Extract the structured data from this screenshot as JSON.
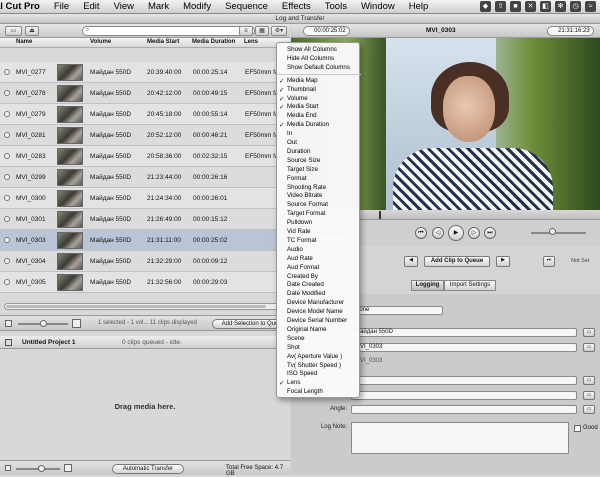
{
  "menubar": {
    "app": "al Cut Pro",
    "items": [
      "File",
      "Edit",
      "View",
      "Mark",
      "Modify",
      "Sequence",
      "Effects",
      "Tools",
      "Window",
      "Help"
    ]
  },
  "window": {
    "title": "Log and Transfer"
  },
  "browser": {
    "columns": [
      "Name",
      "Volume",
      "Media Start",
      "Media Duration",
      "Lens"
    ],
    "rows": [
      {
        "name": "MVI_0277",
        "volume": "Майдан 550D",
        "start": "20:39:40:00",
        "duration": "00:00:25:14",
        "lens": "EF50mm f/"
      },
      {
        "name": "MVI_0278",
        "volume": "Майдан 550D",
        "start": "20:42:12:00",
        "duration": "00:00:49:15",
        "lens": "EF50mm f/"
      },
      {
        "name": "MVI_0279",
        "volume": "Майдан 550D",
        "start": "20:45:18:00",
        "duration": "00:00:55:14",
        "lens": "EF50mm f/"
      },
      {
        "name": "MVI_0281",
        "volume": "Майдан 550D",
        "start": "20:52:12:00",
        "duration": "00:00:46:21",
        "lens": "EF50mm f/"
      },
      {
        "name": "MVI_0283",
        "volume": "Майдан 550D",
        "start": "20:58:36:00",
        "duration": "00:02:32:15",
        "lens": "EF50mm f/"
      },
      {
        "name": "MVI_0299",
        "volume": "Майдан 550D",
        "start": "21:23:44:00",
        "duration": "00:00:26:16",
        "lens": ""
      },
      {
        "name": "MVI_0300",
        "volume": "Майдан 550D",
        "start": "21:24:34:00",
        "duration": "00:00:26:01",
        "lens": ""
      },
      {
        "name": "MVI_0301",
        "volume": "Майдан 550D",
        "start": "21:26:49:00",
        "duration": "00:00:15:12",
        "lens": ""
      },
      {
        "name": "MVI_0303",
        "volume": "Майдан 550D",
        "start": "21:31:11:00",
        "duration": "00:00:25:02",
        "lens": ""
      },
      {
        "name": "MVI_0304",
        "volume": "Майдан 550D",
        "start": "21:32:29:00",
        "duration": "00:00:09:12",
        "lens": ""
      },
      {
        "name": "MVI_0305",
        "volume": "Майдан 550D",
        "start": "21:32:56:00",
        "duration": "00:00:29:03",
        "lens": ""
      }
    ],
    "status": "1 selected - 1 vol... 11 clips displayed",
    "add_selection": "Add Selection to Que",
    "project_name": "Untitled Project 1",
    "queue_status": "0 clips queued - idle.",
    "drop_text": "Drag media here.",
    "auto_transfer": "Automatic Transfer",
    "free_space": "Total Free Space: 4.7 GB"
  },
  "viewer": {
    "timecode_in": "00:00:25:02",
    "clip_name": "MVI_0303",
    "timecode_out": "21:31:16:23",
    "add_clip": "Add Clip to Queue",
    "not_set": "Not Set"
  },
  "logging": {
    "tabs": [
      "Logging",
      "Import Settings"
    ],
    "bin_value": "None",
    "reel_value": "Майдан 550D",
    "name_value": "MVI_0303",
    "name_preview": "MVI_0303",
    "angle_label": "Angle:",
    "lognote_label": "Log Note:",
    "good_label": "Good"
  },
  "column_menu": {
    "top": [
      "Show All Columns",
      "Hide All Columns",
      "Show Default Columns"
    ],
    "items": [
      {
        "label": "Media Map",
        "checked": true
      },
      {
        "label": "Thumbnail",
        "checked": true
      },
      {
        "label": "Volume",
        "checked": true
      },
      {
        "label": "Media Start",
        "checked": true
      },
      {
        "label": "Media End",
        "checked": false
      },
      {
        "label": "Media Duration",
        "checked": true
      },
      {
        "label": "In",
        "checked": false
      },
      {
        "label": "Out",
        "checked": false
      },
      {
        "label": "Duration",
        "checked": false
      },
      {
        "label": "Source Size",
        "checked": false
      },
      {
        "label": "Target Size",
        "checked": false
      },
      {
        "label": "Format",
        "checked": false
      },
      {
        "label": "Shooting Rate",
        "checked": false
      },
      {
        "label": "Video Bitrate",
        "checked": false
      },
      {
        "label": "Source Format",
        "checked": false
      },
      {
        "label": "Target Format",
        "checked": false
      },
      {
        "label": "Pulldown",
        "checked": false
      },
      {
        "label": "Vid Rate",
        "checked": false
      },
      {
        "label": "TC Format",
        "checked": false
      },
      {
        "label": "Audio",
        "checked": false
      },
      {
        "label": "Aud Rate",
        "checked": false
      },
      {
        "label": "Aud Format",
        "checked": false
      },
      {
        "label": "Created By",
        "checked": false
      },
      {
        "label": "Date Created",
        "checked": false
      },
      {
        "label": "Date Modified",
        "checked": false
      },
      {
        "label": "Device Manufacturer",
        "checked": false
      },
      {
        "label": "Device Model Name",
        "checked": false
      },
      {
        "label": "Device Serial Number",
        "checked": false
      },
      {
        "label": "Original Name",
        "checked": false
      },
      {
        "label": "Scene",
        "checked": false
      },
      {
        "label": "Shot",
        "checked": false
      },
      {
        "label": "Av( Aperture Value )",
        "checked": false
      },
      {
        "label": "Tv( Shutter Speed )",
        "checked": false
      },
      {
        "label": "ISO Speed",
        "checked": false
      },
      {
        "label": "Lens",
        "checked": true
      },
      {
        "label": "Focal Length",
        "checked": false
      }
    ]
  }
}
